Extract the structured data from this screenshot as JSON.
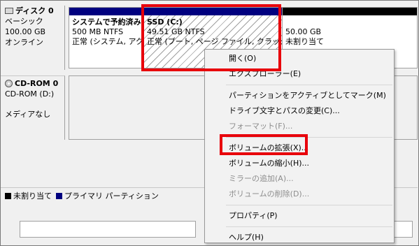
{
  "disk0": {
    "name": "ディスク 0",
    "type": "ベーシック",
    "size": "100.00 GB",
    "status": "オンライン",
    "partitions": [
      {
        "title": "システムで予約済み",
        "size": "500 MB NTFS",
        "status": "正常 (システム, アク"
      },
      {
        "title": "SSD  (C:)",
        "size": "49.51 GB NTFS",
        "status": "正常 (ブート, ページ ファイル, クラッシュ"
      },
      {
        "title": "",
        "size": "50.00 GB",
        "status": "未割り当て"
      }
    ]
  },
  "cdrom": {
    "name": "CD-ROM 0",
    "drive": "CD-ROM (D:)",
    "status": "メディアなし"
  },
  "legend": {
    "unallocated": "未割り当て",
    "primary": "プライマリ パーティション"
  },
  "colors": {
    "primary": "#00007f",
    "unallocated": "#000000",
    "highlight": "#e8000b"
  },
  "menu": {
    "open": "開く(O)",
    "explorer": "エクスプローラー(E)",
    "mark_active": "パーティションをアクティブとしてマーク(M)",
    "change_letter": "ドライブ文字とパスの変更(C)...",
    "format": "フォーマット(F)...",
    "extend": "ボリュームの拡張(X)...",
    "shrink": "ボリュームの縮小(H)...",
    "add_mirror": "ミラーの追加(A)...",
    "delete": "ボリュームの削除(D)...",
    "properties": "プロパティ(P)",
    "help": "ヘルプ(H)"
  }
}
